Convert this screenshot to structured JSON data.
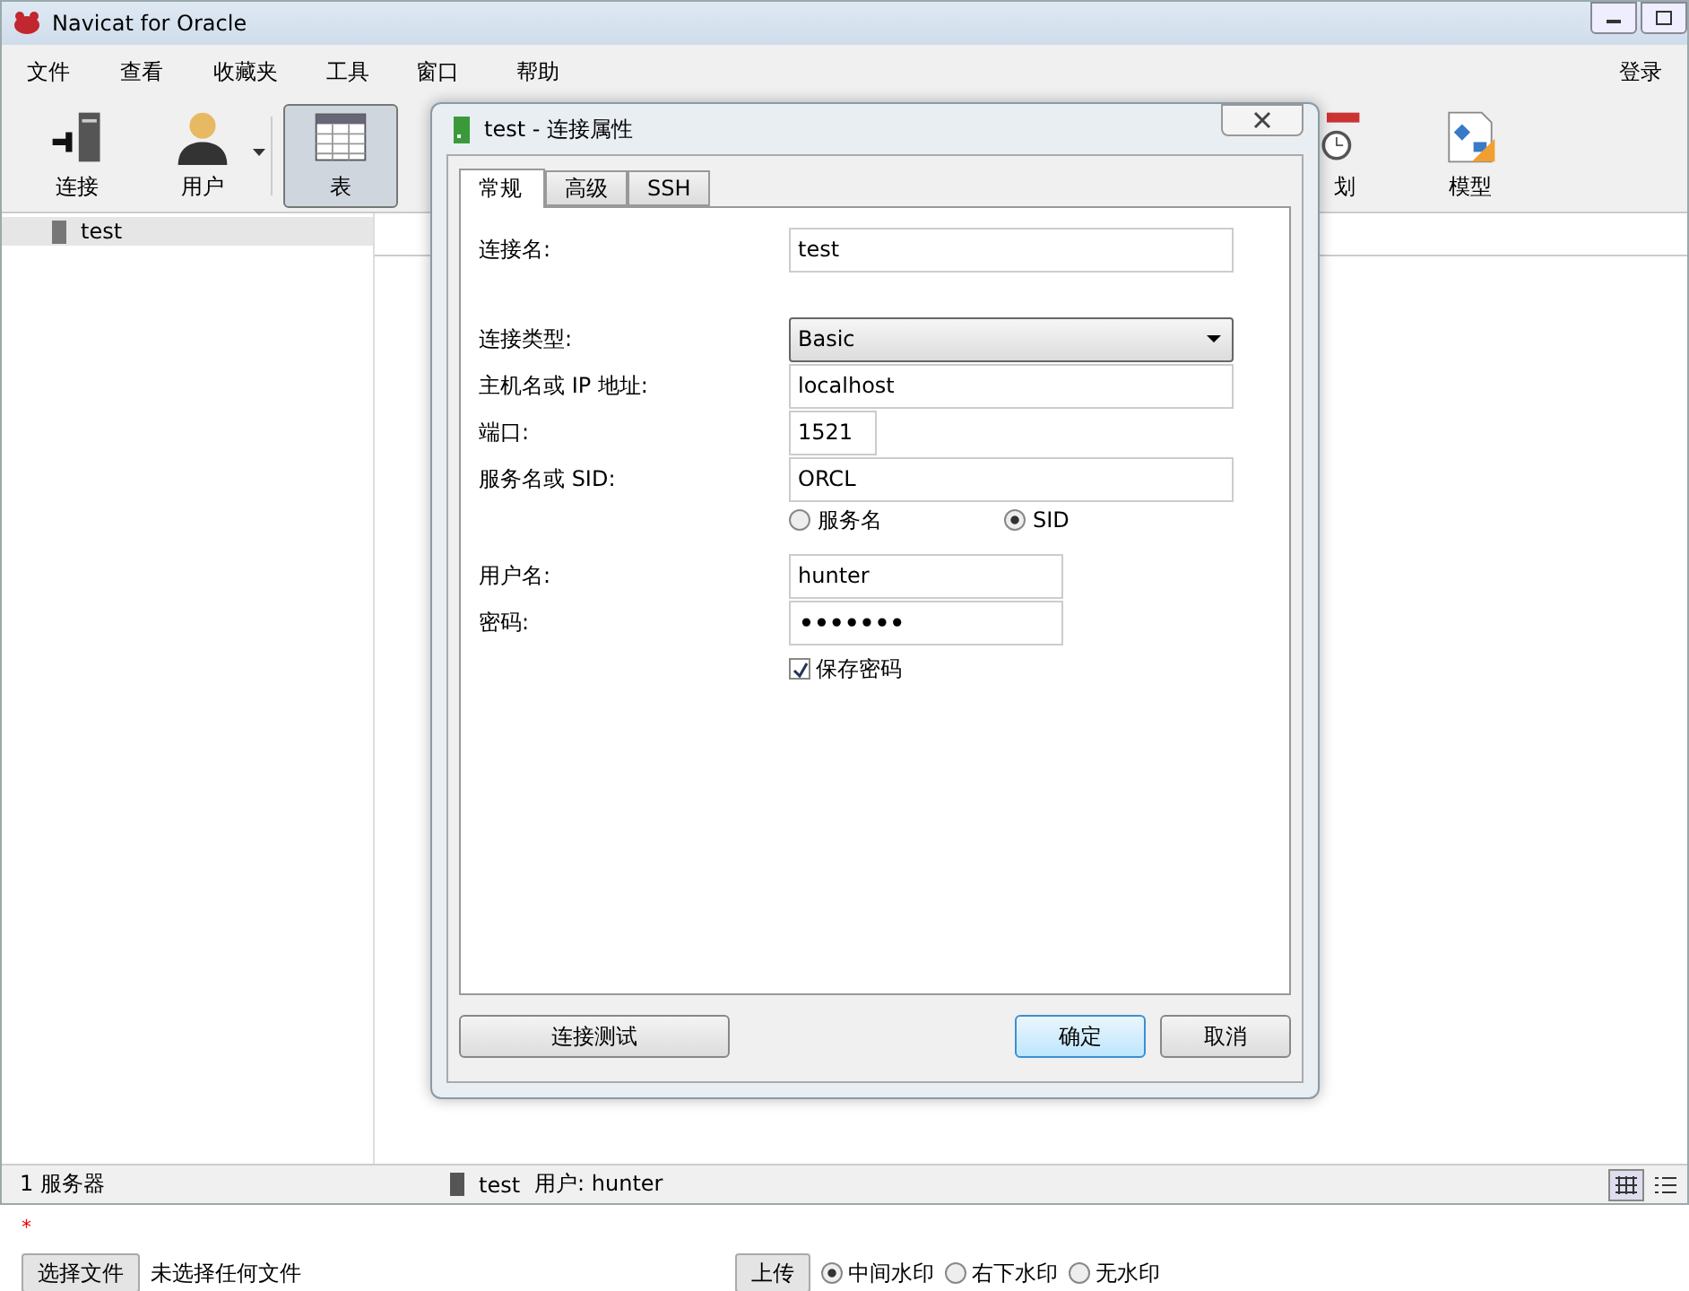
{
  "window": {
    "title": "Navicat for Oracle",
    "menu": [
      "文件",
      "查看",
      "收藏夹",
      "工具",
      "窗口",
      "帮助"
    ],
    "login": "登录"
  },
  "toolbar": [
    {
      "kind": "plug",
      "label": "连接",
      "selected": false,
      "dropdown": false
    },
    {
      "kind": "user",
      "label": "用户",
      "selected": false,
      "dropdown": true
    },
    {
      "kind": "table",
      "label": "表",
      "selected": true,
      "dropdown": false
    },
    {
      "kind": "schedule",
      "label": "划",
      "selected": false,
      "dropdown": false
    },
    {
      "kind": "model",
      "label": "模型",
      "selected": false,
      "dropdown": false
    }
  ],
  "sidebar": {
    "items": [
      {
        "label": "test",
        "selected": true
      }
    ]
  },
  "status_bar": {
    "count": "1 服务器",
    "connection": "test",
    "user": "用户: hunter",
    "views": [
      {
        "kind": "grid",
        "selected": true
      },
      {
        "kind": "list",
        "selected": false
      }
    ]
  },
  "dialog": {
    "title": "test - 连接属性",
    "tabs": [
      {
        "label": "常规",
        "selected": true
      },
      {
        "label": "高级",
        "selected": false
      },
      {
        "label": "SSH",
        "selected": false
      }
    ],
    "fields": [
      {
        "kind": "text",
        "label": "连接名:",
        "value": "test"
      },
      {
        "kind": "select",
        "label": "连接类型:",
        "value": "Basic"
      },
      {
        "kind": "text",
        "label": "主机名或 IP 地址:",
        "value": "localhost"
      },
      {
        "kind": "text",
        "label": "端口:",
        "value": "1521"
      },
      {
        "kind": "text",
        "label": "服务名或 SID:",
        "value": "ORCL"
      },
      {
        "kind": "radios",
        "options": [
          {
            "label": "服务名",
            "selected": false
          },
          {
            "label": "SID",
            "selected": true
          }
        ]
      },
      {
        "kind": "text",
        "label": "用户名:",
        "value": "hunter"
      },
      {
        "kind": "password",
        "label": "密码:",
        "value": "•••••••"
      },
      {
        "kind": "checkbox",
        "label": "保存密码",
        "checked": true
      }
    ],
    "buttons": [
      {
        "label": "连接测试",
        "kind": "test"
      },
      {
        "label": "确定",
        "kind": "default"
      },
      {
        "label": "取消",
        "kind": "normal"
      }
    ]
  },
  "web_form": {
    "required_mark": "*",
    "file_button": "选择文件",
    "file_status": "未选择任何文件",
    "upload_button": "上传",
    "watermark_options": [
      {
        "label": "中间水印",
        "selected": true
      },
      {
        "label": "右下水印",
        "selected": false
      },
      {
        "label": "无水印",
        "selected": false
      }
    ]
  }
}
